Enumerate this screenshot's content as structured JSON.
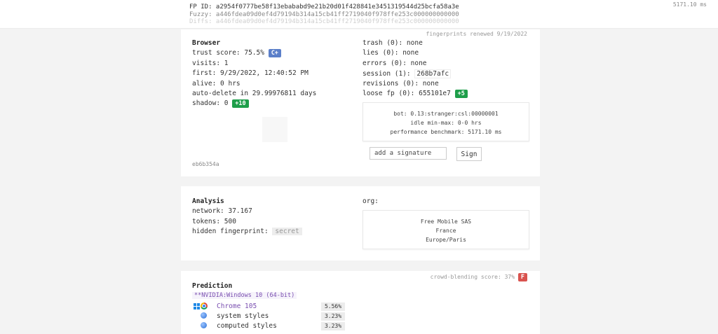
{
  "header": {
    "fp_id": "FP ID: a2954f0777be58f13ebababd9e21b20d01f428841e3451319544d25bcfa58a3e",
    "fuzzy": "Fuzzy: a446fdea09d0ef4d79194b314a15cb41ff2719040f978ffe253c000000000000",
    "diffs": "Diffs: a446fdea09d0ef4d79194b314a15cb41ff2719040f978ffe253c000000000000",
    "timing": "5171.10 ms"
  },
  "browser": {
    "renewed": "fingerprints renewed 9/19/2022",
    "title": "Browser",
    "trust_score": "trust score: 75.5%",
    "trust_grade": "C+",
    "visits": "visits: 1",
    "first": "first: 9/29/2022, 12:40:52 PM",
    "alive": "alive: 0 hrs",
    "auto_delete": "auto-delete in 29.99976811 days",
    "shadow": "shadow: 0",
    "shadow_badge": "+10",
    "trash": "trash (0): none",
    "lies": "lies (0): none",
    "errors": "errors (0): none",
    "session_label": "session (1):",
    "session_hash": "268b7afc",
    "revisions": "revisions (0): none",
    "loose_label": "loose fp (0):",
    "loose_hash": "655101e7",
    "loose_badge": "+5",
    "bot_info": {
      "bot": "bot: 0.13:stranger:csl:00000001",
      "idle": "idle min-max: 0-0 hrs",
      "perf": "performance benchmark: 5171.10 ms"
    },
    "signature_placeholder": "add a signature",
    "sign_label": "Sign",
    "hash": "eb6b354a"
  },
  "analysis": {
    "title": "Analysis",
    "network": "network: 37.167",
    "tokens": "tokens: 500",
    "hidden_label": "hidden fingerprint:",
    "hidden_value": "secret",
    "org_label": "org:",
    "org": {
      "name": "Free Mobile SAS",
      "country": "France",
      "timezone": "Europe/Paris"
    }
  },
  "prediction": {
    "title": "Prediction",
    "crowd_label": "crowd-blending score: 37%",
    "crowd_grade": "F",
    "gpu": "**NVIDIA:Windows 10 (64-bit)",
    "rows": [
      {
        "label": "Chrome 105",
        "pct": "5.56%"
      },
      {
        "label": "system styles",
        "pct": "3.23%"
      },
      {
        "label": "computed styles",
        "pct": "3.23%"
      }
    ]
  },
  "colors": {
    "badge_blue": "#5b7fc9",
    "badge_green": "#1e9e4a",
    "badge_red": "#d9534f",
    "accent_purple": "#7a4fb0"
  }
}
